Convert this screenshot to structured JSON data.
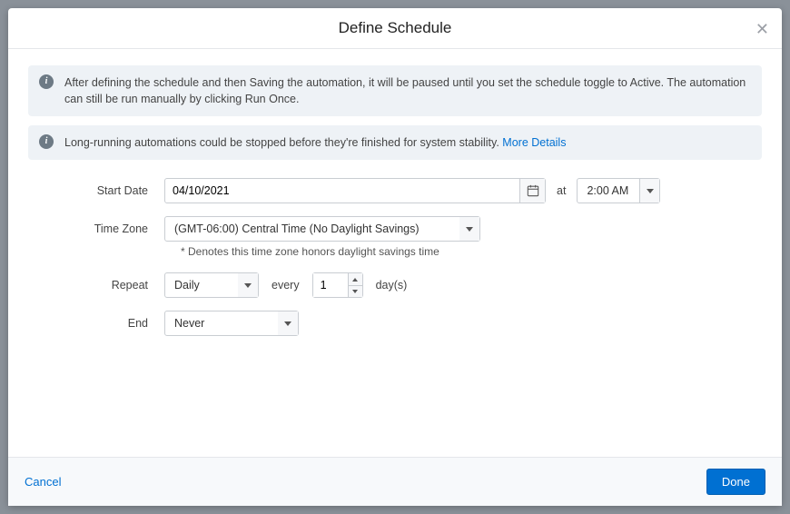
{
  "modal": {
    "title": "Define Schedule",
    "close_glyph": "✕"
  },
  "info_boxes": [
    {
      "text": "After defining the schedule and then Saving the automation, it will be paused until you set the schedule toggle to Active. The automation can still be run manually by clicking Run Once."
    },
    {
      "text": "Long-running automations could be stopped before they're finished for system stability. ",
      "link": "More Details"
    }
  ],
  "labels": {
    "start_date": "Start Date",
    "time_zone": "Time Zone",
    "repeat": "Repeat",
    "end": "End",
    "at": "at",
    "every": "every",
    "days_unit": "day(s)"
  },
  "values": {
    "start_date": "04/10/2021",
    "start_time": "2:00 AM",
    "time_zone": "(GMT-06:00) Central Time (No Daylight Savings)",
    "tz_helper": "* Denotes this time zone honors daylight savings time",
    "repeat": "Daily",
    "every_count": "1",
    "end": "Never"
  },
  "footer": {
    "cancel": "Cancel",
    "done": "Done"
  }
}
